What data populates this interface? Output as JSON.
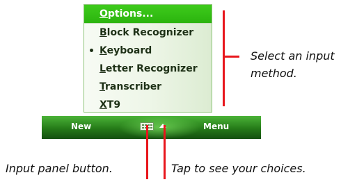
{
  "menu": {
    "items": [
      {
        "label": "Options...",
        "selected": true,
        "bullet": false
      },
      {
        "label": "Block Recognizer",
        "selected": false,
        "bullet": false
      },
      {
        "label": "Keyboard",
        "selected": false,
        "bullet": true
      },
      {
        "label": "Letter Recognizer",
        "selected": false,
        "bullet": false
      },
      {
        "label": "Transcriber",
        "selected": false,
        "bullet": false
      },
      {
        "label": "XT9",
        "selected": false,
        "bullet": false
      }
    ]
  },
  "taskbar": {
    "left_softkey": "New",
    "right_softkey": "Menu",
    "input_panel_icon": "keyboard-icon",
    "arrow_icon": "up-arrow-icon"
  },
  "callouts": {
    "select_line1": "Select an input",
    "select_line2": "method.",
    "input_panel": "Input panel button.",
    "tap_choices": "Tap to see your choices."
  },
  "colors": {
    "accent_green": "#2bb40e",
    "callout_red": "#e8161c",
    "taskbar_dark": "#145010"
  }
}
